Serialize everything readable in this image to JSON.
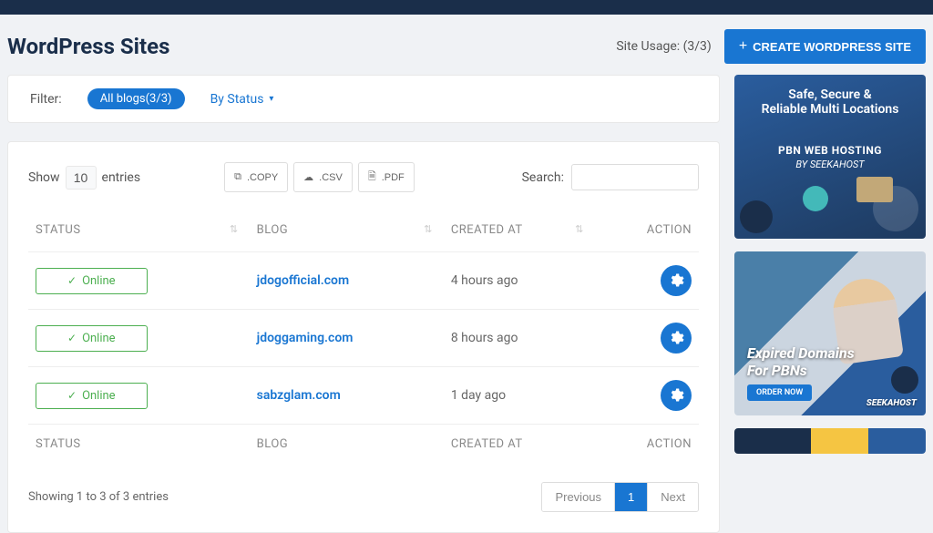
{
  "header": {
    "title": "WordPress Sites",
    "usage_label": "Site Usage: (3/3)",
    "create_button": "CREATE WORDPRESS SITE"
  },
  "filter": {
    "label": "Filter:",
    "all_blogs": "All blogs(3/3)",
    "by_status": "By Status"
  },
  "table_controls": {
    "show_label": "Show",
    "show_value": "10",
    "entries_label": "entries",
    "copy": ".COPY",
    "csv": ".CSV",
    "pdf": ".PDF",
    "search_label": "Search:"
  },
  "columns": {
    "status": "STATUS",
    "blog": "BLOG",
    "created": "CREATED AT",
    "action": "ACTION"
  },
  "rows": [
    {
      "status": "Online",
      "blog": "jdogofficial.com",
      "created": "4 hours ago"
    },
    {
      "status": "Online",
      "blog": "jdoggaming.com",
      "created": "8 hours ago"
    },
    {
      "status": "Online",
      "blog": "sabzglam.com",
      "created": "1 day ago"
    }
  ],
  "footer": {
    "showing": "Showing 1 to 3 of 3 entries",
    "previous": "Previous",
    "page": "1",
    "next": "Next"
  },
  "ads": {
    "ad1_line1a": "Safe, Secure &",
    "ad1_line1b": "Reliable Multi Locations",
    "ad1_line2": "PBN WEB HOSTING",
    "ad1_line3": "BY SEEKAHOST",
    "ad2_line1": "Expired Domains",
    "ad2_line2": "For PBNs",
    "ad2_order": "ORDER NOW",
    "ad2_logo": "SEEKAHOST"
  }
}
